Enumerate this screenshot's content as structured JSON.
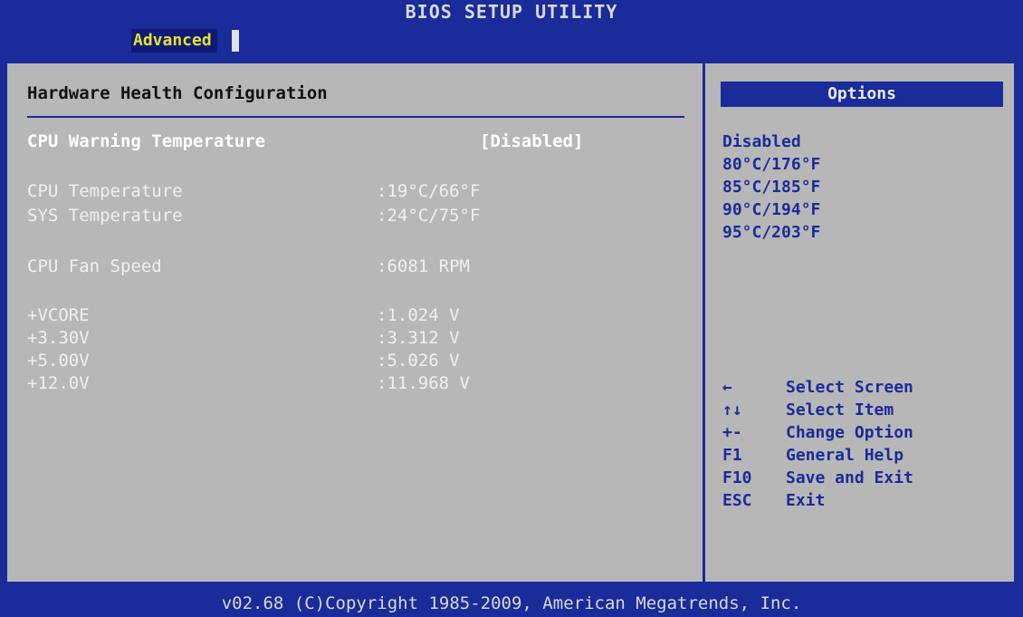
{
  "title": "BIOS SETUP UTILITY",
  "menu": {
    "active_tab": "Advanced"
  },
  "main": {
    "section_title": "Hardware Health Configuration",
    "setting": {
      "label": "CPU Warning Temperature",
      "value": "[Disabled]"
    },
    "readings": [
      {
        "label": "CPU Temperature",
        "value": ":19°C/66°F"
      },
      {
        "label": "SYS Temperature",
        "value": ":24°C/75°F"
      },
      {
        "label": "CPU Fan Speed",
        "value": ":6081 RPM"
      },
      {
        "label": "+VCORE",
        "value": ":1.024 V"
      },
      {
        "label": "+3.30V",
        "value": ":3.312 V"
      },
      {
        "label": "+5.00V",
        "value": ":5.026 V"
      },
      {
        "label": "+12.0V",
        "value": ":11.968 V"
      }
    ]
  },
  "options_panel": {
    "header": "Options",
    "options": [
      "Disabled",
      "80°C/176°F",
      "85°C/185°F",
      "90°C/194°F",
      "95°C/203°F"
    ],
    "keys": [
      {
        "key": "←",
        "desc": "Select Screen"
      },
      {
        "key": "↑↓",
        "desc": "Select Item"
      },
      {
        "key": "+-",
        "desc": "Change Option"
      },
      {
        "key": "F1",
        "desc": "General Help"
      },
      {
        "key": "F10",
        "desc": "Save and Exit"
      },
      {
        "key": "ESC",
        "desc": "Exit"
      }
    ]
  },
  "footer": "v02.68 (C)Copyright 1985-2009, American Megatrends, Inc.",
  "colors": {
    "background": "#1a2b9a",
    "panel": "#b7b7b7",
    "highlight": "#e8e030"
  }
}
